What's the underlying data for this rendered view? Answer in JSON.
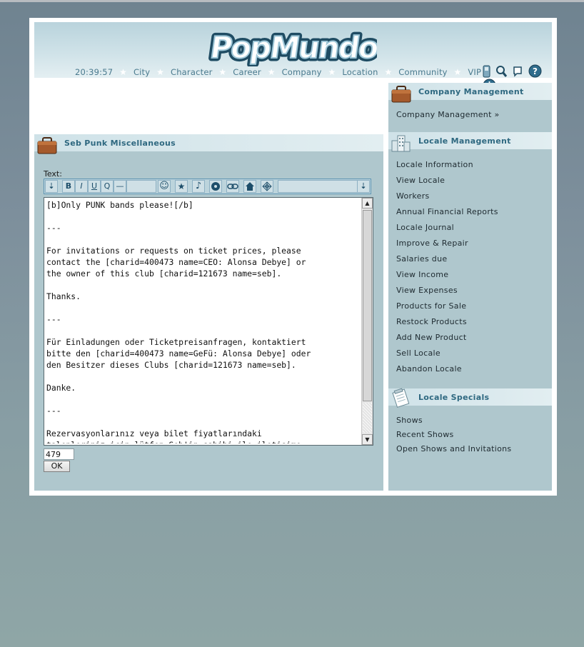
{
  "header": {
    "logo_text": "PopMundo",
    "clock": "20:39:57",
    "nav": [
      "City",
      "Character",
      "Career",
      "Company",
      "Location",
      "Community",
      "VIP"
    ],
    "tool_icons": [
      "mobile-phone-icon",
      "search-icon",
      "notes-icon",
      "help-icon",
      "logout-icon"
    ]
  },
  "main": {
    "title": "Seb Punk Miscellaneous",
    "text_label": "Text:",
    "toolbar_buttons": [
      "B",
      "I",
      "U",
      "Q",
      "—"
    ],
    "editor_text": "[b]Only PUNK bands please![/b]\n\n---\n\nFor invitations or requests on ticket prices, please\ncontact the [charid=400473 name=CEO: Alonsa Debye] or\nthe owner of this club [charid=121673 name=seb].\n\nThanks.\n\n---\n\nFür Einladungen oder Ticketpreisanfragen, kontaktiert\nbitte den [charid=400473 name=GeFü: Alonsa Debye] oder\nden Besitzer dieses Clubs [charid=121673 name=seb].\n\nDanke.\n\n---\n\nRezervasyonlarınız veya bilet fiyatlarındaki\ntalepleriniz için lütfen Seb'in sahibi ile iletişime",
    "char_count": "479",
    "ok_label": "OK"
  },
  "sidebar": {
    "company": {
      "title": "Company Management",
      "links": [
        "Company Management »"
      ]
    },
    "locale": {
      "title": "Locale Management",
      "links": [
        "Locale Information",
        "View Locale",
        "Workers",
        "Annual Financial Reports",
        "Locale Journal",
        "Improve & Repair",
        "Salaries due",
        "View Income",
        "View Expenses",
        "Products for Sale",
        "Restock Products",
        "Add New Product",
        "Sell Locale",
        "Abandon Locale"
      ]
    },
    "specials": {
      "title": "Locale Specials",
      "links": [
        "Shows",
        "Recent Shows",
        "Open Shows and Invitations"
      ]
    }
  },
  "colors": {
    "accent": "#2e6880",
    "panel": "#afc7cd",
    "header_bar": "#cfe2e8",
    "nav_text": "#4a7a8e"
  }
}
